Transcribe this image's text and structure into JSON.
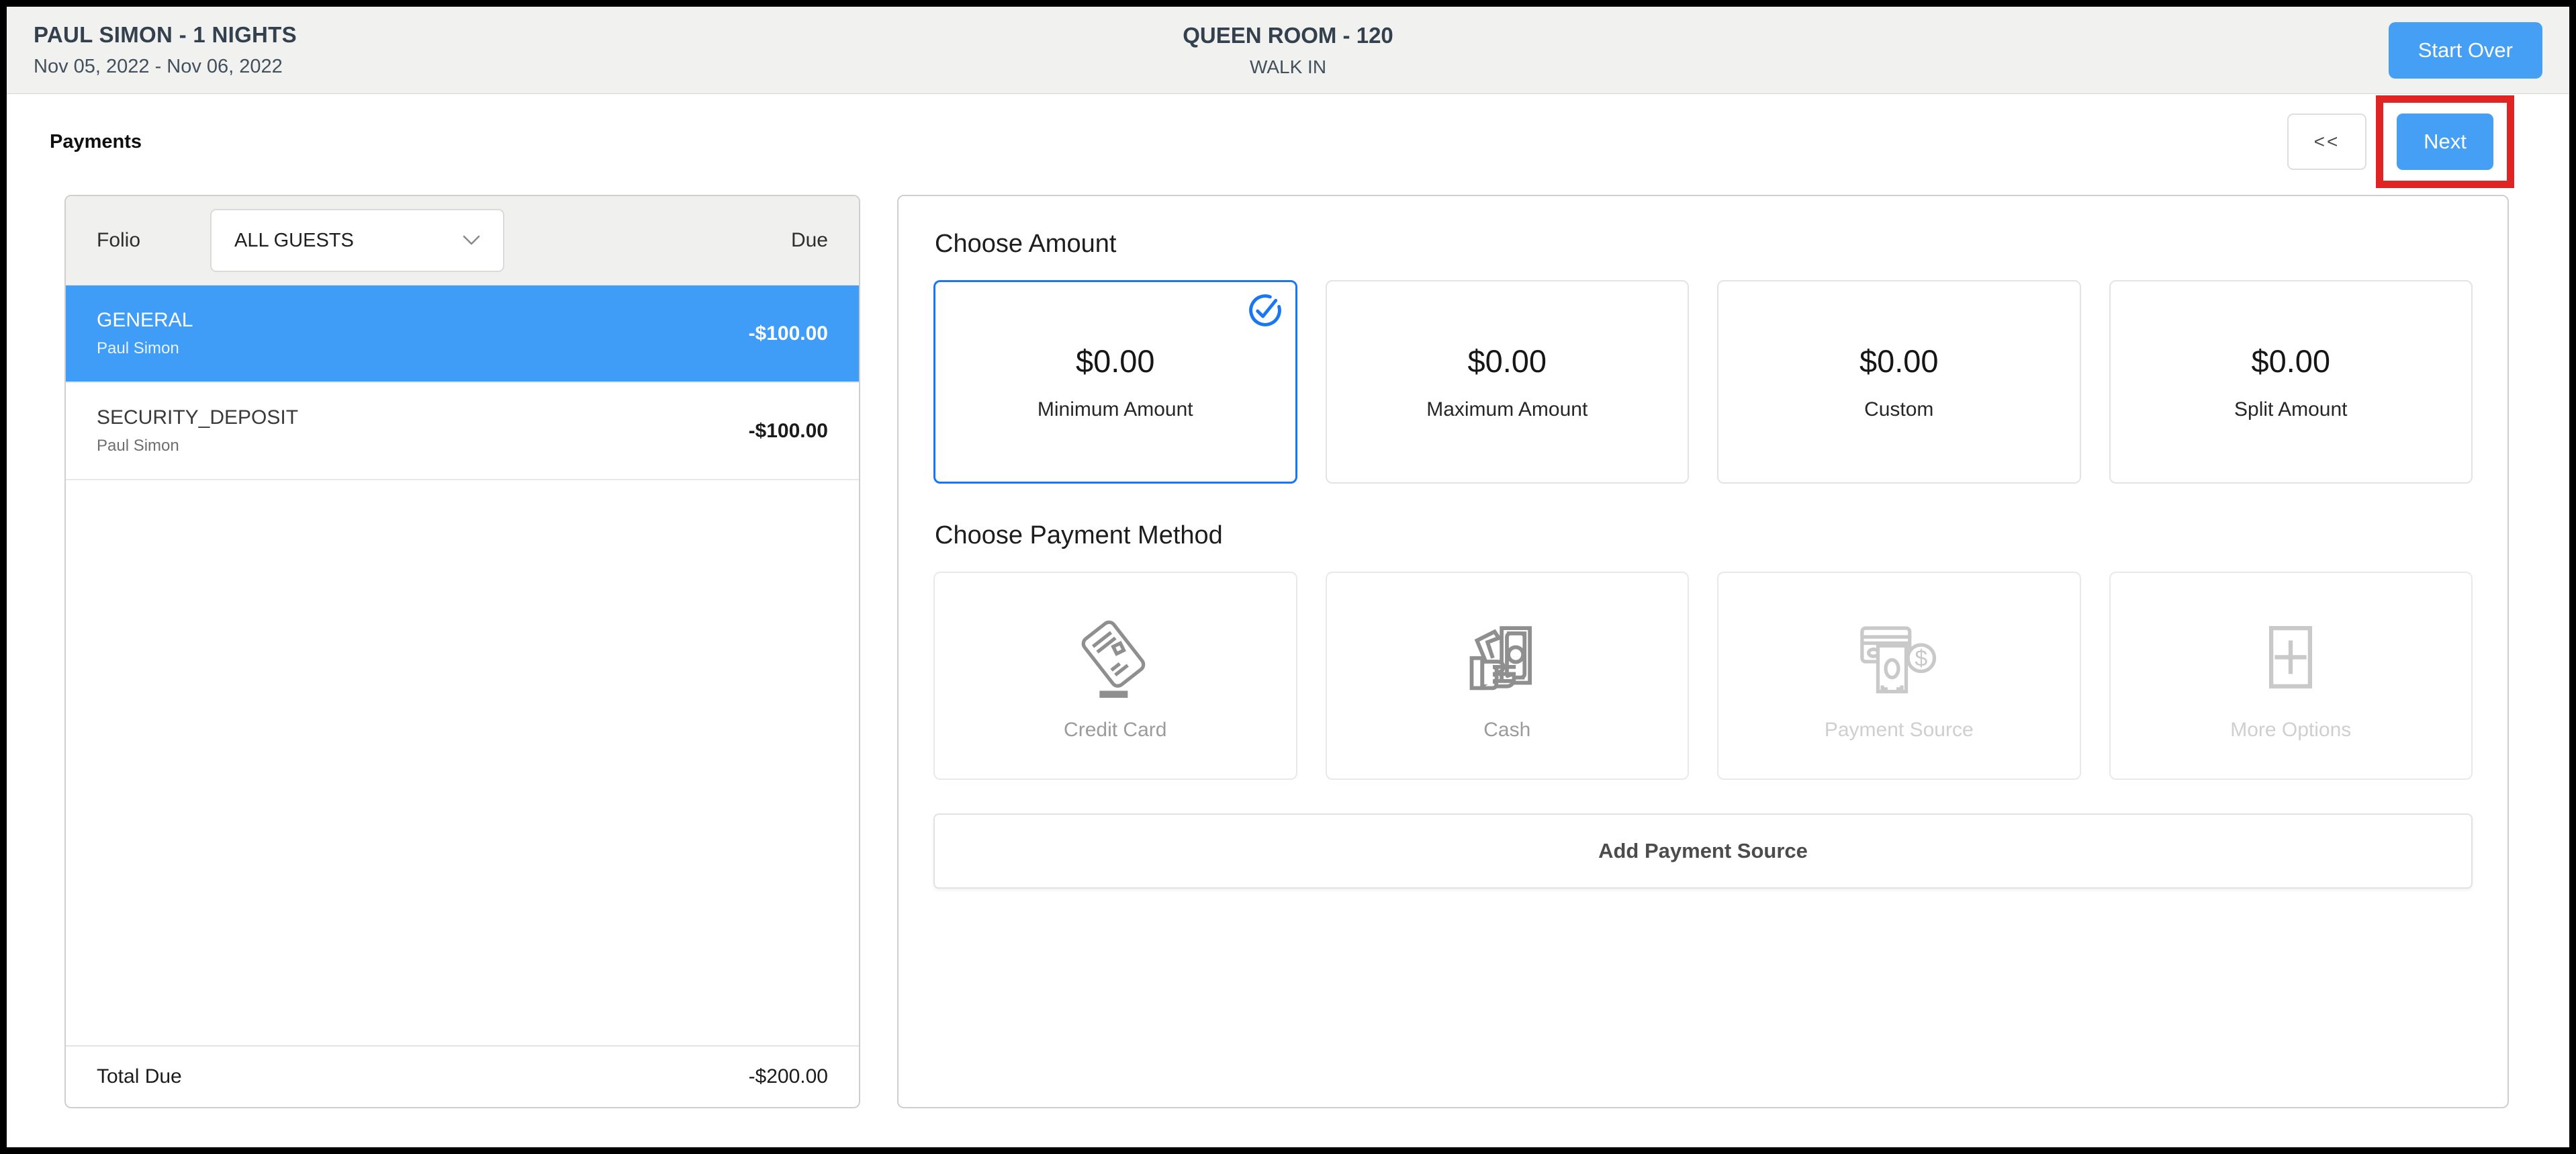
{
  "header": {
    "guest_title": "PAUL SIMON - 1 NIGHTS",
    "date_range": "Nov 05, 2022 - Nov 06, 2022",
    "room_title": "QUEEN ROOM - 120",
    "booking_type": "WALK IN",
    "start_over_label": "Start Over"
  },
  "toolbar": {
    "page_title": "Payments",
    "back_label": "<<",
    "next_label": "Next"
  },
  "folio_panel": {
    "folio_label": "Folio",
    "guest_filter_value": "ALL GUESTS",
    "due_label": "Due",
    "rows": [
      {
        "name": "GENERAL",
        "guest": "Paul Simon",
        "due": "-$100.00",
        "selected": true
      },
      {
        "name": "SECURITY_DEPOSIT",
        "guest": "Paul Simon",
        "due": "-$100.00",
        "selected": false
      }
    ],
    "total_label": "Total Due",
    "total_due": "-$200.00"
  },
  "amount_section": {
    "title": "Choose Amount",
    "options": [
      {
        "amount": "$0.00",
        "label": "Minimum Amount",
        "selected": true
      },
      {
        "amount": "$0.00",
        "label": "Maximum Amount",
        "selected": false
      },
      {
        "amount": "$0.00",
        "label": "Custom",
        "selected": false
      },
      {
        "amount": "$0.00",
        "label": "Split Amount",
        "selected": false
      }
    ]
  },
  "method_section": {
    "title": "Choose Payment Method",
    "options": [
      {
        "label": "Credit Card",
        "icon": "credit-card-icon",
        "disabled": false
      },
      {
        "label": "Cash",
        "icon": "cash-icon",
        "disabled": false
      },
      {
        "label": "Payment Source",
        "icon": "payment-source-icon",
        "disabled": true
      },
      {
        "label": "More Options",
        "icon": "more-options-icon",
        "disabled": true
      }
    ],
    "add_source_label": "Add Payment Source"
  },
  "colors": {
    "accent_blue": "#459ff5",
    "selected_row_blue": "#3f9cf7",
    "selected_border_blue": "#1877f2",
    "annotation_red": "#e02424",
    "icon_gray": "#8f8f8f",
    "disabled_icon_gray": "#c9c9c9",
    "header_bar_gray": "#f1f1f0"
  }
}
